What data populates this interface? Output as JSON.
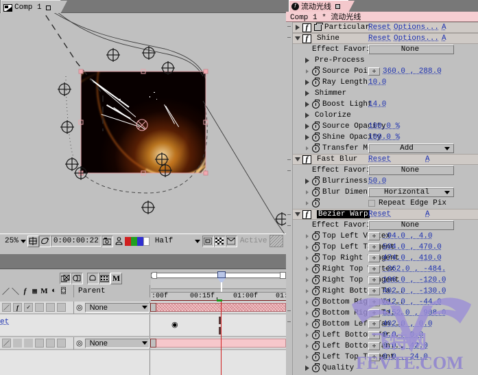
{
  "comp_viewer": {
    "tab_label": "Comp 1",
    "toolbar": {
      "zoom": "25%",
      "timecode": "0:00:00:22",
      "resolution": "Half",
      "active_label": "Active",
      "icons": [
        "zoom-dropdown",
        "safe-grid-icon",
        "mask-icon",
        "timecode-field",
        "snapshot-icon",
        "show-snapshot-icon",
        "channel-red",
        "channel-green",
        "channel-blue",
        "channel-alpha",
        "resolution-dropdown",
        "region-of-interest-icon",
        "transparency-grid-icon",
        "render-icon"
      ]
    }
  },
  "timeline": {
    "tools": [
      "layer-switches-icon",
      "transfer-controls-icon",
      "inout-panel-icon",
      "render-time-icon",
      "motion-blur-M-icon"
    ],
    "switch_headers": [
      "shy-icon",
      "collapse-icon",
      "quality-icon",
      "effects-fx-icon",
      "frame-blend-icon",
      "motion-blur-M-icon",
      "adjustment-icon",
      "3d-layer-icon"
    ],
    "parent_header": "Parent",
    "ruler_ticks": [
      ":00f",
      "00:15f",
      "01:00f",
      "01:"
    ],
    "rows": [
      {
        "parent": "None",
        "switches": [
          "quality",
          "fx",
          "",
          "visible",
          "",
          ""
        ],
        "bar": "textured"
      },
      {
        "parent": "None",
        "switches": [
          "quality",
          "",
          "",
          "",
          "",
          ""
        ],
        "bar": "plain"
      }
    ],
    "cut_label": "et"
  },
  "effect_controls": {
    "tab_label": "流动光线",
    "subtitle": "Comp 1 * 流动光线",
    "reset_label": "Reset",
    "options_label": "Options...",
    "about_label": "A",
    "rows": [
      {
        "kind": "effect",
        "open": false,
        "name": "Particular",
        "layericon": true,
        "value": "reset-options"
      },
      {
        "kind": "effect",
        "open": true,
        "name": "Shine",
        "layericon": false,
        "value": "reset-options"
      },
      {
        "kind": "favorites",
        "name": "Effect Favorites",
        "value": "None"
      },
      {
        "kind": "group",
        "arrow": "closed",
        "name": "Pre-Process"
      },
      {
        "kind": "prop",
        "arrow": "tiny",
        "stopwatch": true,
        "name": "Source Point",
        "xy": true,
        "value": "360.0 , 288.0"
      },
      {
        "kind": "prop",
        "arrow": "closed",
        "stopwatch": true,
        "name": "Ray Length",
        "value": "10.0"
      },
      {
        "kind": "group",
        "arrow": "closed",
        "name": "Shimmer"
      },
      {
        "kind": "prop",
        "arrow": "closed",
        "stopwatch": true,
        "name": "Boost Light",
        "value": "14.0"
      },
      {
        "kind": "group",
        "arrow": "closed",
        "name": "Colorize"
      },
      {
        "kind": "prop",
        "arrow": "closed",
        "stopwatch": true,
        "name": "Source Opacity",
        "value": "100.0 %"
      },
      {
        "kind": "prop",
        "arrow": "closed",
        "stopwatch": true,
        "name": "Shine Opacity",
        "value": "100.0 %"
      },
      {
        "kind": "dropdown",
        "arrow": "tiny",
        "stopwatch": true,
        "name": "Transfer Mode...",
        "value": "Add"
      },
      {
        "kind": "effect",
        "open": true,
        "name": "Fast Blur",
        "layericon": false,
        "value": "reset"
      },
      {
        "kind": "favorites",
        "name": "Effect Favorites",
        "value": "None"
      },
      {
        "kind": "prop",
        "arrow": "closed",
        "stopwatch": true,
        "name": "Blurriness",
        "value": "50.0"
      },
      {
        "kind": "dropdown",
        "arrow": "tiny",
        "stopwatch": true,
        "name": "Blur Dimensions",
        "value": "Horizontal"
      },
      {
        "kind": "checkbox",
        "arrow": "tiny",
        "stopwatch": true,
        "name": "",
        "value": "Repeat Edge Pix"
      },
      {
        "kind": "effect",
        "open": true,
        "name": "Bezier Warp",
        "selected": true,
        "layericon": false,
        "value": "reset"
      },
      {
        "kind": "favorites",
        "name": "Effect Favorites",
        "value": "None"
      },
      {
        "kind": "prop",
        "arrow": "tiny",
        "stopwatch": true,
        "name": "Top Left Vertex",
        "xy": true,
        "value": "-94.0 , 4.0"
      },
      {
        "kind": "prop",
        "arrow": "tiny",
        "stopwatch": true,
        "name": "Top Left Tangent",
        "xy": true,
        "value": "504.0 , 470.0"
      },
      {
        "kind": "prop",
        "arrow": "tiny",
        "stopwatch": true,
        "name": "Top Right Tangent",
        "xy": true,
        "value": "474.0 , 410.0"
      },
      {
        "kind": "prop",
        "arrow": "tiny",
        "stopwatch": true,
        "name": "Right Top Vertex",
        "xy": true,
        "value": "-362.0 , -484."
      },
      {
        "kind": "prop",
        "arrow": "tiny",
        "stopwatch": true,
        "name": "Right Top Tangent",
        "xy": true,
        "value": "196.0 , -120.0"
      },
      {
        "kind": "prop",
        "arrow": "tiny",
        "stopwatch": true,
        "name": "Right Bottom Ta...",
        "xy": true,
        "value": "402.0 , -130.0"
      },
      {
        "kind": "prop",
        "arrow": "tiny",
        "stopwatch": true,
        "name": "Bottom Right Ve...",
        "xy": true,
        "value": "512.0 , -44.0"
      },
      {
        "kind": "prop",
        "arrow": "tiny",
        "stopwatch": true,
        "name": "Bottom Right Ta...",
        "xy": true,
        "value": "1152.0 , 908.0"
      },
      {
        "kind": "prop",
        "arrow": "tiny",
        "stopwatch": true,
        "name": "Bottom Left Tan...",
        "xy": true,
        "value": "402.0 , 0.0"
      },
      {
        "kind": "prop",
        "arrow": "tiny",
        "stopwatch": true,
        "name": "Left Bottom Ver...",
        "xy": true,
        "value": "0.0 , 0.0"
      },
      {
        "kind": "prop",
        "arrow": "tiny",
        "stopwatch": true,
        "name": "Left Bottom Tan...",
        "xy": true,
        "value": "0.0 , 42.0"
      },
      {
        "kind": "prop",
        "arrow": "tiny",
        "stopwatch": true,
        "name": "Left Top Tangent",
        "xy": true,
        "value": "0.0 , 24.0"
      },
      {
        "kind": "prop",
        "arrow": "closed",
        "stopwatch": true,
        "name": "Quality",
        "value": ""
      }
    ]
  },
  "watermark": {
    "site": "FEVTE.COM",
    "cn": "飞特网",
    "color": "#9b8fd6"
  },
  "colors": {
    "panel_bg": "#c0c0c0",
    "tabbar": "#787878",
    "fx_tab_pink": "#f4c8cc",
    "link_blue": "#1b2fb0",
    "timeline_bar_pink": "#f0b9bd",
    "selection_black": "#000000"
  }
}
